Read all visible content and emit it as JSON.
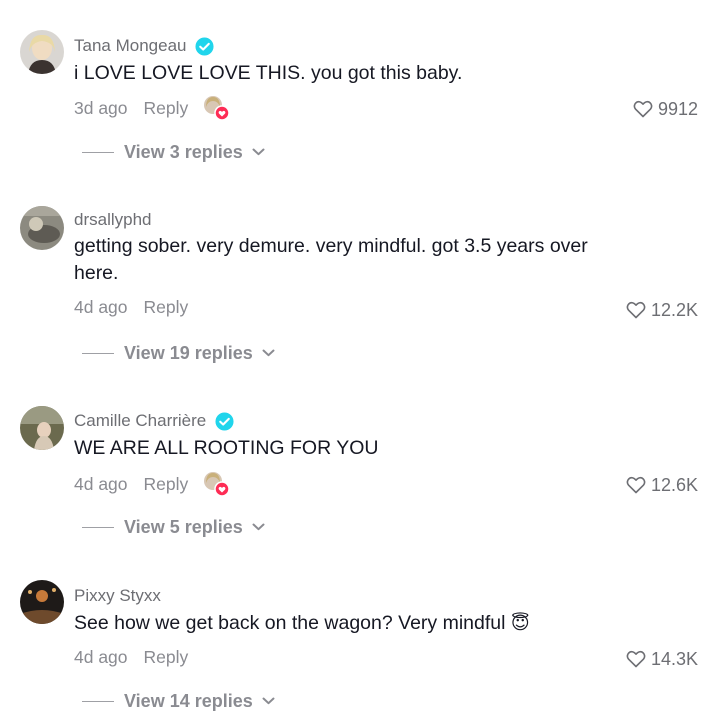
{
  "comments": [
    {
      "author": "Tana Mongeau",
      "verified": true,
      "text": "i LOVE LOVE LOVE THIS. you got this baby.",
      "time": "3d ago",
      "reply": "Reply",
      "creator_liked": true,
      "likes": "9912",
      "view_replies": "View 3 replies"
    },
    {
      "author": "drsallyphd",
      "verified": false,
      "text": "getting sober. very demure. very mindful. got 3.5 years over here.",
      "time": "4d ago",
      "reply": "Reply",
      "creator_liked": false,
      "likes": "12.2K",
      "view_replies": "View 19 replies"
    },
    {
      "author": "Camille Charrière",
      "verified": true,
      "text": "WE ARE ALL ROOTING FOR YOU",
      "time": "4d ago",
      "reply": "Reply",
      "creator_liked": true,
      "likes": "12.6K",
      "view_replies": "View 5 replies"
    },
    {
      "author": "Pixxy Styxx",
      "verified": false,
      "text": "See how we get back on the wagon? Very mindful",
      "emoji": "😇",
      "time": "4d ago",
      "reply": "Reply",
      "creator_liked": false,
      "likes": "14.3K",
      "view_replies": "View 14 replies"
    }
  ],
  "icons": {
    "verified": "verified-badge-icon",
    "like": "heart-outline-icon",
    "chevron": "chevron-down-icon",
    "creator_liked": "creator-liked-heart-icon"
  },
  "colors": {
    "verified": "#20d5ec",
    "creator_heart": "#fe2c55",
    "secondary_text": "#8a8b91"
  }
}
